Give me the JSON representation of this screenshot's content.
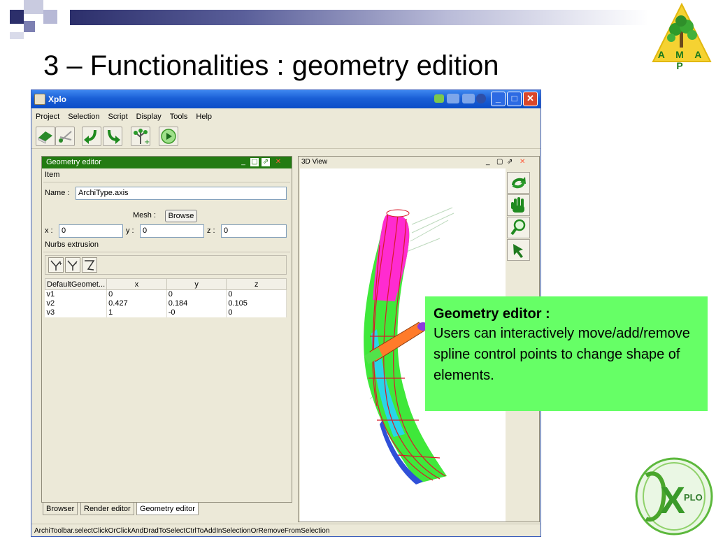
{
  "slide": {
    "title": "3 – Functionalities : geometry edition",
    "logo_amap_text": "A M A P",
    "logo_xplo_text": "PLO",
    "logo_xplo_letter": "X",
    "accent_color": "#2c2f6b"
  },
  "window": {
    "title": "Xplo",
    "menu": [
      "Project",
      "Selection",
      "Script",
      "Display",
      "Tools",
      "Help"
    ],
    "toolbar_icons": [
      "eraser-icon",
      "scissors-icon",
      "redo-arrow-icon",
      "undo-arrow-icon",
      "plant-add-icon",
      "play-icon"
    ],
    "status_text": "ArchiToolbar.selectClickOrClickAndDradToSelectCtrlToAddInSelectionOrRemoveFromSelection"
  },
  "geometry_editor": {
    "title": "Geometry editor",
    "item_label": "Item",
    "name_label": "Name :",
    "name_value": "ArchiType.axis",
    "mesh_label": "Mesh :",
    "browse_label": "Browse",
    "x_label": "x :",
    "x_value": "0",
    "y_label": "y :",
    "y_value": "0",
    "z_label": "z :",
    "z_value": "0",
    "nurbs_label": "Nurbs extrusion",
    "table": {
      "headers": [
        "DefaultGeomet...",
        "x",
        "y",
        "z"
      ],
      "rows": [
        [
          "v1",
          "0",
          "0",
          "0"
        ],
        [
          "v2",
          "0.427",
          "0.184",
          "0.105"
        ],
        [
          "v3",
          "1",
          "-0",
          "0"
        ]
      ]
    },
    "tabs": [
      "Browser",
      "Render editor",
      "Geometry editor"
    ],
    "active_tab": "Geometry editor"
  },
  "view3d": {
    "title": "3D View",
    "tools": [
      "rotate-icon",
      "hand-pan-icon",
      "zoom-icon",
      "select-arrow-icon"
    ]
  },
  "callout": {
    "heading": "Geometry editor :",
    "body": "Users can interactively move/add/remove spline control points to change shape of elements.",
    "bg_color": "#66ff66"
  }
}
